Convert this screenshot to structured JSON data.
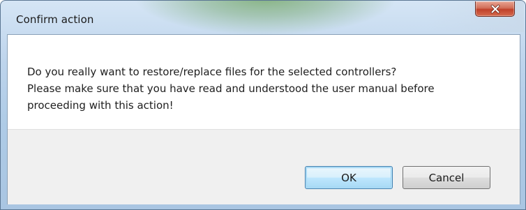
{
  "window": {
    "title": "Confirm action",
    "close_icon": "close-icon"
  },
  "message": {
    "lines": [
      "Do you really want to restore/replace files for the selected controllers?",
      "Please make sure that you have read and understood the user manual before",
      "proceeding with this action!"
    ]
  },
  "buttons": {
    "ok_label": "OK",
    "cancel_label": "Cancel"
  },
  "colors": {
    "close_button": "#c0412a",
    "default_button_border": "#3c7fb1",
    "footer_background": "#f0f0f0"
  }
}
